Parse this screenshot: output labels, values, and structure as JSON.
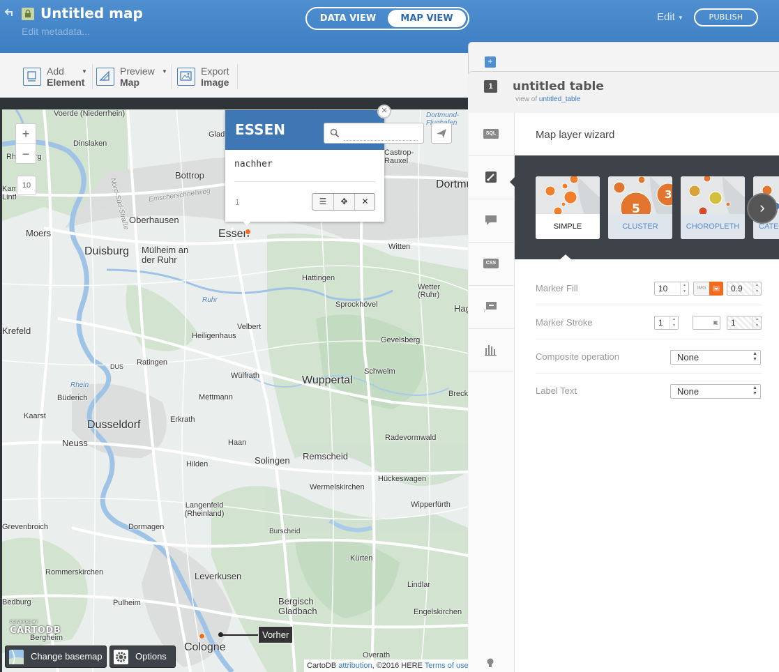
{
  "header": {
    "title": "Untitled map",
    "edit_metadata": "Edit metadata...",
    "tabs": [
      "DATA VIEW",
      "MAP VIEW"
    ],
    "edit_label": "Edit",
    "publish_label": "PUBLISH",
    "bg_color": "#4080c4"
  },
  "toolbar": {
    "items": [
      {
        "line1": "Add",
        "line2": "Element"
      },
      {
        "line1": "Preview",
        "line2": "Map"
      },
      {
        "line1": "Export",
        "line2": "Image"
      }
    ]
  },
  "map": {
    "zoom_in": "+",
    "zoom_out": "−",
    "zoom_level": "10",
    "places": [
      "Voerde (Niederrhein)",
      "Dinslaken",
      "Rheinberg",
      "Bottrop",
      "Gladbeck",
      "Emscherschnellweg",
      "Nord-Süd-Straße",
      "Oberhausen",
      "Moers",
      "Duisburg",
      "Mülheim an der Ruhr",
      "Essen",
      "Witten",
      "Dortmund",
      "Dortmund-Flughafen",
      "Castrop-Rauxel",
      "Hattingen",
      "Wetter (Ruhr)",
      "Ruhr",
      "Sprockhövel",
      "Velbert",
      "Heiligenhaus",
      "Gevelsberg",
      "Hagen",
      "Krefeld",
      "Ratingen",
      "DUS",
      "Wülfrath",
      "Wuppertal",
      "Schwelm",
      "Rhein",
      "Büderich",
      "Mettmann",
      "Kaarst",
      "Dusseldorf",
      "Erkrath",
      "Neuss",
      "Haan",
      "Radevormwald",
      "Solingen",
      "Remscheid",
      "Hilden",
      "Wermelskirchen",
      "Hückeswagen",
      "Langenfeld (Rheinland)",
      "Wipperfürth",
      "Grevenbroich",
      "Dormagen",
      "Burscheid",
      "Kürten",
      "Rommerskirchen",
      "Leverkusen",
      "Lindlar",
      "Bedburg",
      "Pulheim",
      "Bergisch Gladbach",
      "Engelskirchen",
      "Bergheim",
      "Cologne",
      "Overath",
      "Breckerfeld",
      "Kamp-Lintfort"
    ],
    "infowindow": {
      "title": "ESSEN",
      "value": "nachher",
      "page": "1",
      "header_color": "#3f77b4"
    },
    "search_placeholder": "",
    "tooltip": "Vorher",
    "change_basemap": "Change basemap",
    "options": "Options",
    "powered_by": "POWERED BY",
    "logo_text": "CARTODB",
    "attribution": {
      "prefix": "CartoDB",
      "link1": "attribution",
      "mid": ", ©2016 HERE",
      "link2": "Terms of use"
    },
    "marker_color": "#f26b1d"
  },
  "panel": {
    "add_layer": "+",
    "layer_number": "1",
    "table_name": "untitled table",
    "view_of_prefix": "view of",
    "view_of_link": "untitled_table",
    "sidebar": [
      "SQL",
      "wizard",
      "infowindow",
      "CSS",
      "legend",
      "widgets"
    ],
    "wizard_title": "Map layer wizard",
    "wizard_types": [
      "SIMPLE",
      "CLUSTER",
      "CHOROPLETH",
      "CATEGORY"
    ],
    "wizard_cluster_digits": [
      "5",
      "3"
    ],
    "properties": {
      "marker_fill": {
        "label": "Marker Fill",
        "size": "10",
        "img": "IMG",
        "opacity": "0.9",
        "color": "#f26b1d"
      },
      "marker_stroke": {
        "label": "Marker Stroke",
        "width": "1",
        "opacity": "1"
      },
      "composite": {
        "label": "Composite operation",
        "value": "None"
      },
      "label_text": {
        "label": "Label Text",
        "value": "None"
      }
    }
  }
}
